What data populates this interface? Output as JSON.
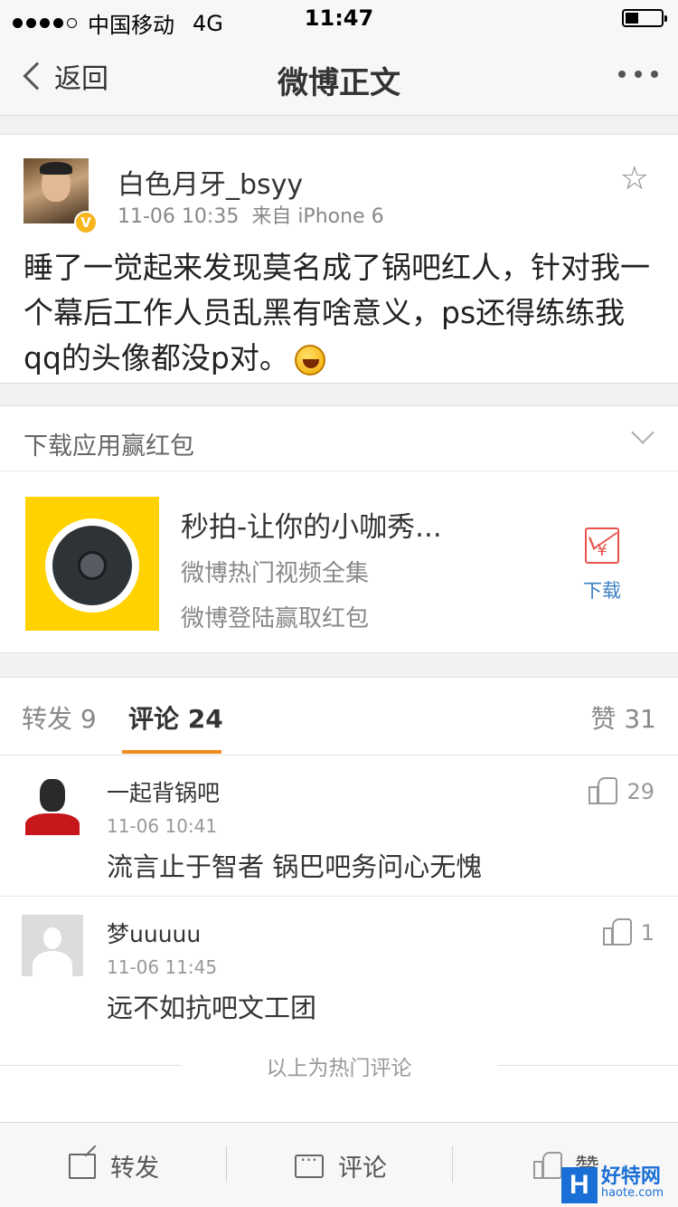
{
  "status_bar": {
    "carrier": "中国移动",
    "network": "4G",
    "time": "11:47"
  },
  "nav": {
    "back_label": "返回",
    "title": "微博正文"
  },
  "post": {
    "username": "白色月牙_bsyy",
    "verified_badge": "V",
    "timestamp": "11-06 10:35",
    "source": "来自 iPhone 6",
    "text": "睡了一觉起来发现莫名成了锅吧红人，针对我一个幕后工作人员乱黑有啥意义，ps还得练练我qq的头像都没p对。"
  },
  "ad": {
    "header": "下载应用赢红包",
    "app_name": "秒拍-让你的小咖秀...",
    "line1": "微博热门视频全集",
    "line2": "微博登陆赢取红包",
    "download_label": "下载",
    "icon_glyph": "¥"
  },
  "tabs": {
    "repost": "转发 9",
    "comment": "评论 24",
    "like": "赞 31"
  },
  "comments": [
    {
      "name": "一起背锅吧",
      "time": "11-06 10:41",
      "text": "流言止于智者 锅巴吧务问心无愧",
      "likes": "29"
    },
    {
      "name": "梦uuuuu",
      "time": "11-06 11:45",
      "text": "远不如抗吧文工团",
      "likes": "1"
    }
  ],
  "hot_divider": "以上为热门评论",
  "toolbar": {
    "repost": "转发",
    "comment": "评论",
    "like": "赞"
  },
  "watermark": {
    "logo": "H",
    "name": "好特网",
    "url": "haote.com"
  },
  "colors": {
    "accent_orange": "#f18a1f",
    "verified_yellow": "#f7b51e",
    "link_blue": "#3a7fc4",
    "redpacket_red": "#e8524a"
  }
}
